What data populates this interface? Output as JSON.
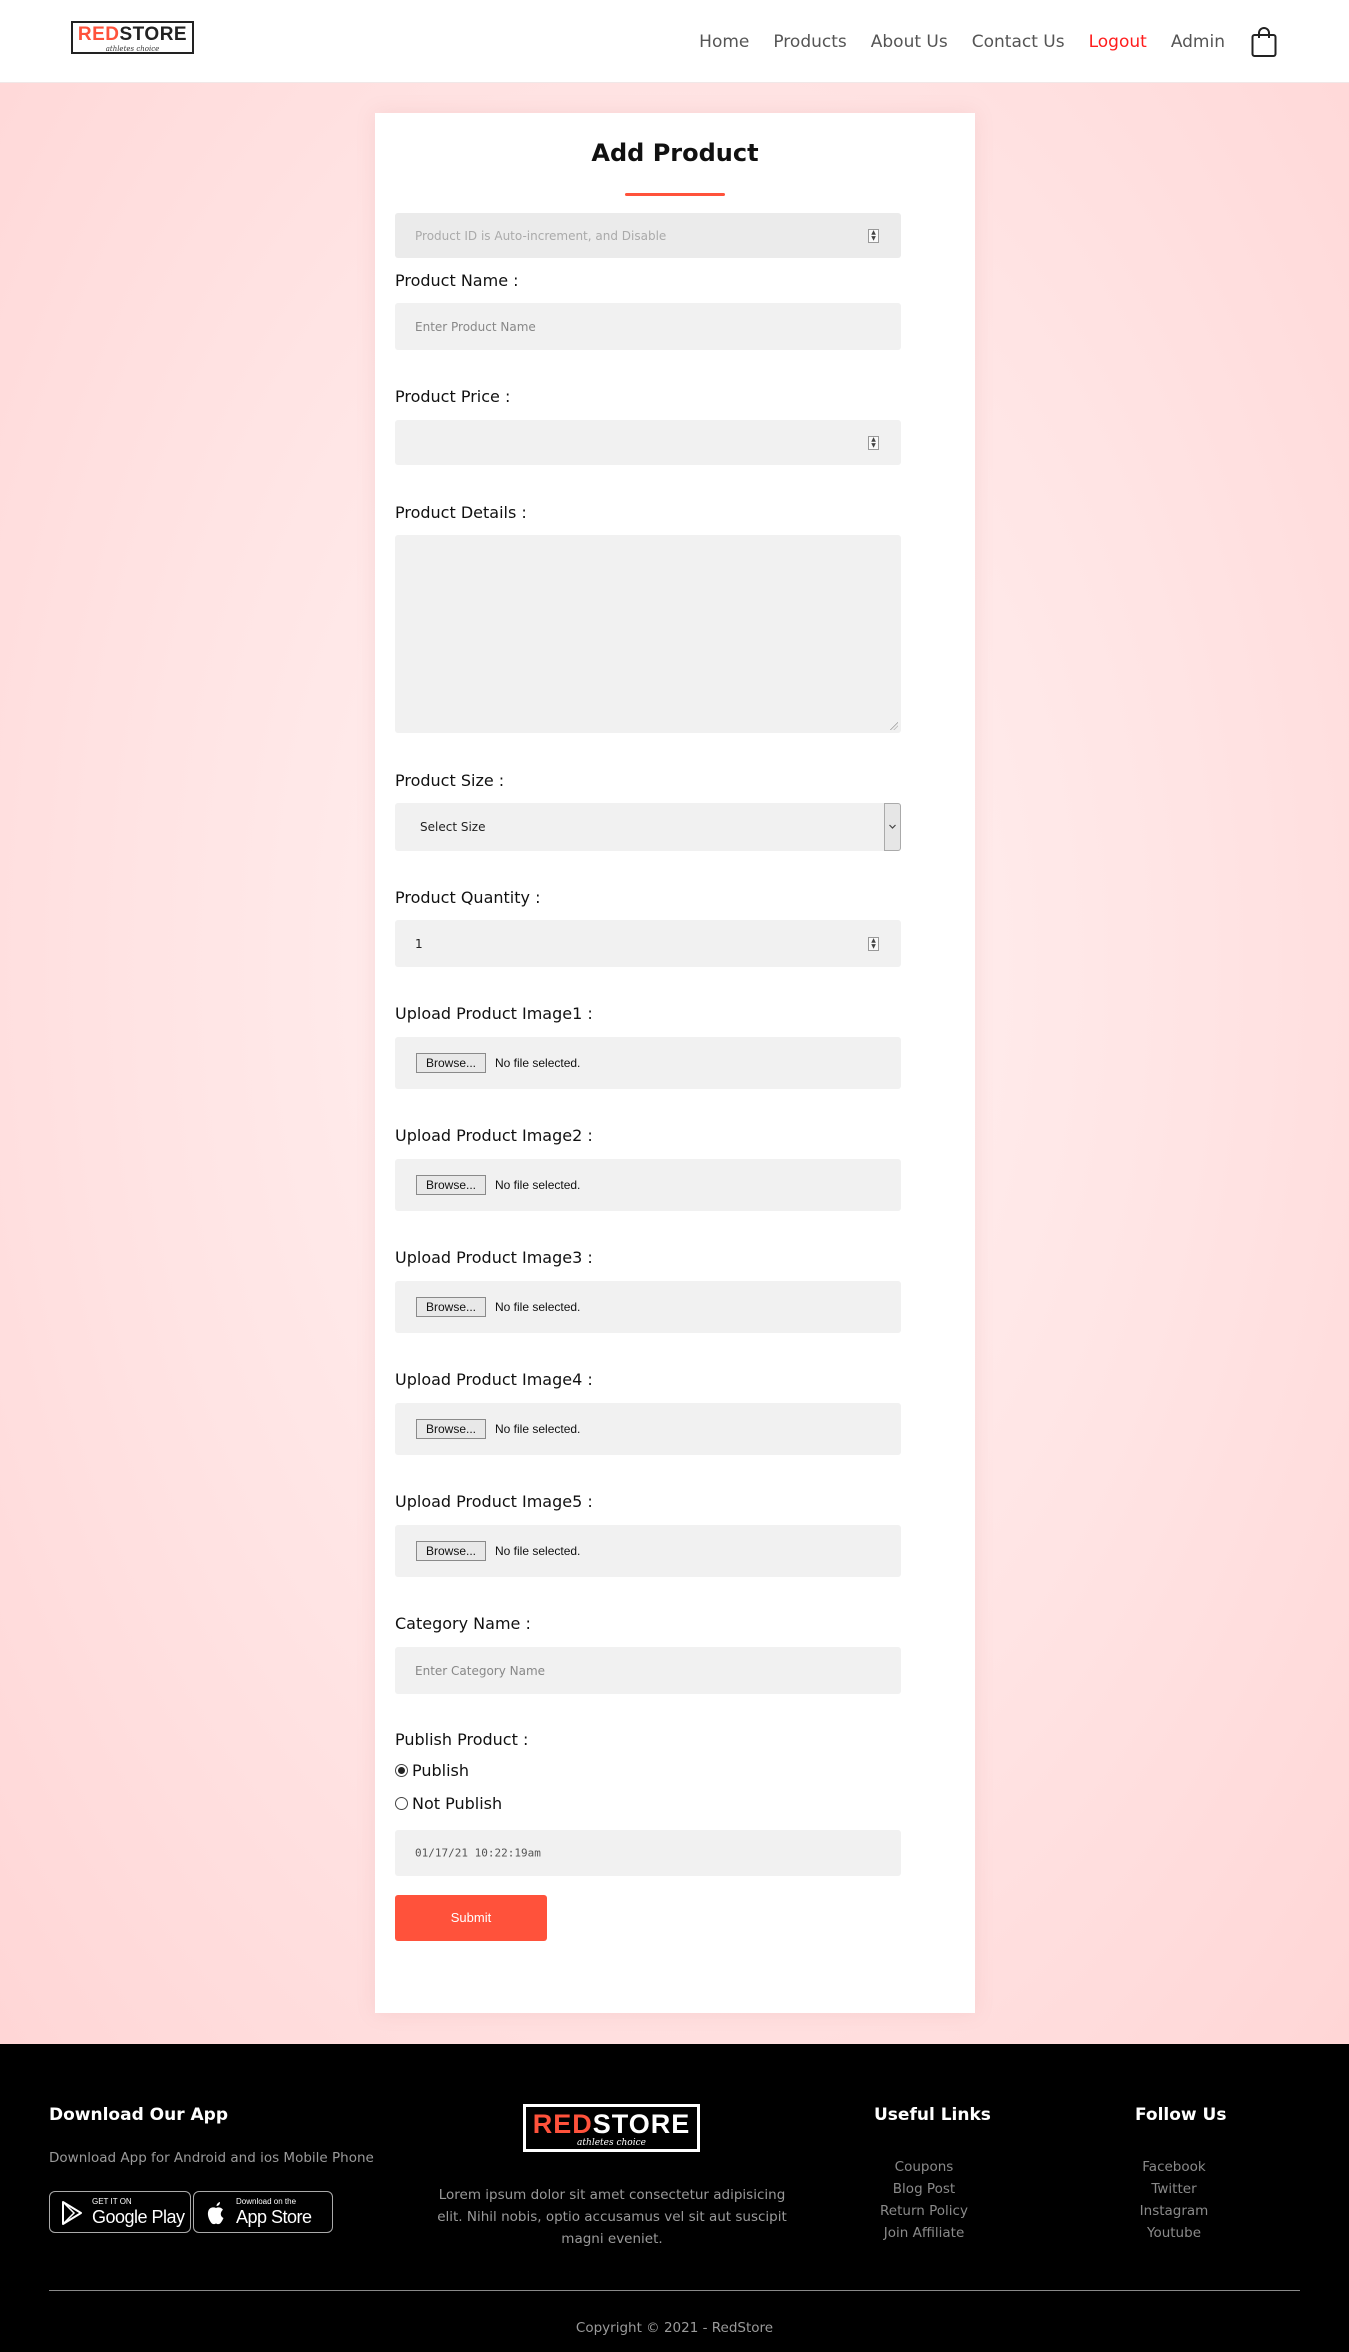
{
  "brand": {
    "name_red": "RED",
    "name_rest": "STORE",
    "tagline": "athletes choice"
  },
  "nav": {
    "items": [
      {
        "label": "Home"
      },
      {
        "label": "Products"
      },
      {
        "label": "About Us"
      },
      {
        "label": "Contact Us"
      },
      {
        "label": "Logout"
      },
      {
        "label": "Admin"
      }
    ],
    "cart_icon": "shopping-bag-icon"
  },
  "form": {
    "title": "Add Product",
    "product_id": {
      "placeholder": "Product ID is Auto-increment, and Disable"
    },
    "product_name": {
      "label": "Product Name :",
      "placeholder": "Enter Product Name"
    },
    "product_price": {
      "label": "Product Price :",
      "value": ""
    },
    "product_details": {
      "label": "Product Details :",
      "value": ""
    },
    "product_size": {
      "label": "Product Size :",
      "selected": "Select Size"
    },
    "product_quantity": {
      "label": "Product Quantity :",
      "value": "1"
    },
    "uploads": [
      {
        "label": "Upload Product Image1 :",
        "button": "Browse...",
        "status": "No file selected."
      },
      {
        "label": "Upload Product Image2 :",
        "button": "Browse...",
        "status": "No file selected."
      },
      {
        "label": "Upload Product Image3 :",
        "button": "Browse...",
        "status": "No file selected."
      },
      {
        "label": "Upload Product Image4 :",
        "button": "Browse...",
        "status": "No file selected."
      },
      {
        "label": "Upload Product Image5 :",
        "button": "Browse...",
        "status": "No file selected."
      }
    ],
    "category_name": {
      "label": "Category Name :",
      "placeholder": "Enter Category Name"
    },
    "publish": {
      "label": "Publish Product :",
      "options": [
        {
          "label": "Publish",
          "checked": true
        },
        {
          "label": "Not Publish",
          "checked": false
        }
      ]
    },
    "timestamp": "01/17/21 10:22:19am",
    "submit_label": "Submit"
  },
  "footer": {
    "download_title": "Download Our App",
    "download_text": "Download App for Android and ios Mobile Phone",
    "google_play": {
      "small": "GET IT ON",
      "big": "Google Play"
    },
    "app_store": {
      "small": "Download on the",
      "big": "App Store"
    },
    "description": "Lorem ipsum dolor sit amet consectetur adipisicing elit. Nihil nobis, optio accusamus vel sit aut suscipit magni eveniet.",
    "useful_links": {
      "title": "Useful Links",
      "items": [
        "Coupons",
        "Blog Post",
        "Return Policy",
        "Join Affiliate"
      ]
    },
    "follow_us": {
      "title": "Follow Us",
      "items": [
        "Facebook",
        "Twitter",
        "Instagram",
        "Youtube"
      ]
    },
    "copyright": "Copyright © 2021 - RedStore"
  },
  "colors": {
    "accent": "#ff523b",
    "logout": "#ff1c1c",
    "footer_bg": "#000000"
  }
}
